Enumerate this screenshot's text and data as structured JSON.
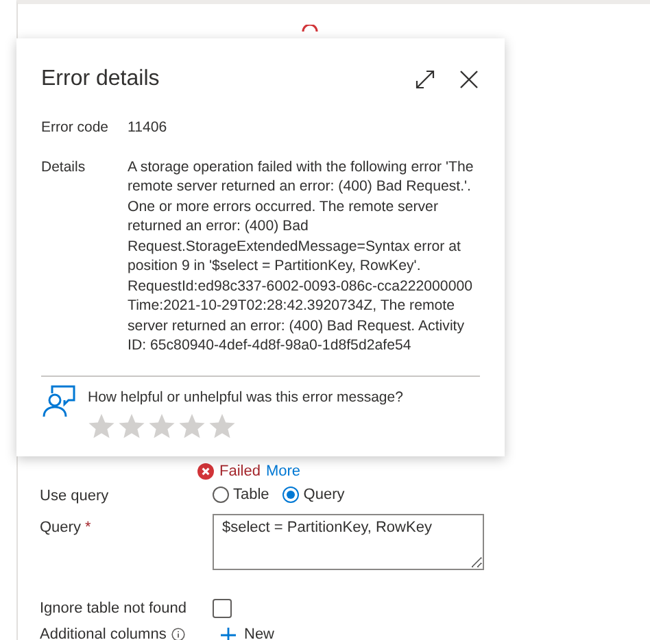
{
  "dialog": {
    "title": "Error details",
    "fields": [
      {
        "label": "Error code",
        "value": "11406"
      },
      {
        "label": "Details",
        "value": "A storage operation failed with the following error 'The remote server returned an error: (400) Bad Request.'. One or more errors occurred. The remote server returned an error: (400) Bad Request.StorageExtendedMessage=Syntax error at position 9 in '$select = PartitionKey, RowKey'. RequestId:ed98c337-6002-0093-086c-cca222000000 Time:2021-10-29T02:28:42.3920734Z, The remote server returned an error: (400) Bad Request. Activity ID: 65c80940-4def-4d8f-98a0-1d8f5d2afe54"
      }
    ],
    "feedback": {
      "question": "How helpful or unhelpful was this error message?",
      "stars": 0
    }
  },
  "status": {
    "text": "Failed",
    "link": "More"
  },
  "form": {
    "use_query": {
      "label": "Use query",
      "options": [
        {
          "label": "Table",
          "selected": false
        },
        {
          "label": "Query",
          "selected": true
        }
      ]
    },
    "query": {
      "label": "Query",
      "required_mark": "*",
      "value": "$select = PartitionKey, RowKey"
    },
    "ignore_table_not_found": {
      "label": "Ignore table not found",
      "checked": false
    },
    "additional_columns": {
      "label": "Additional columns",
      "button": "New"
    }
  }
}
